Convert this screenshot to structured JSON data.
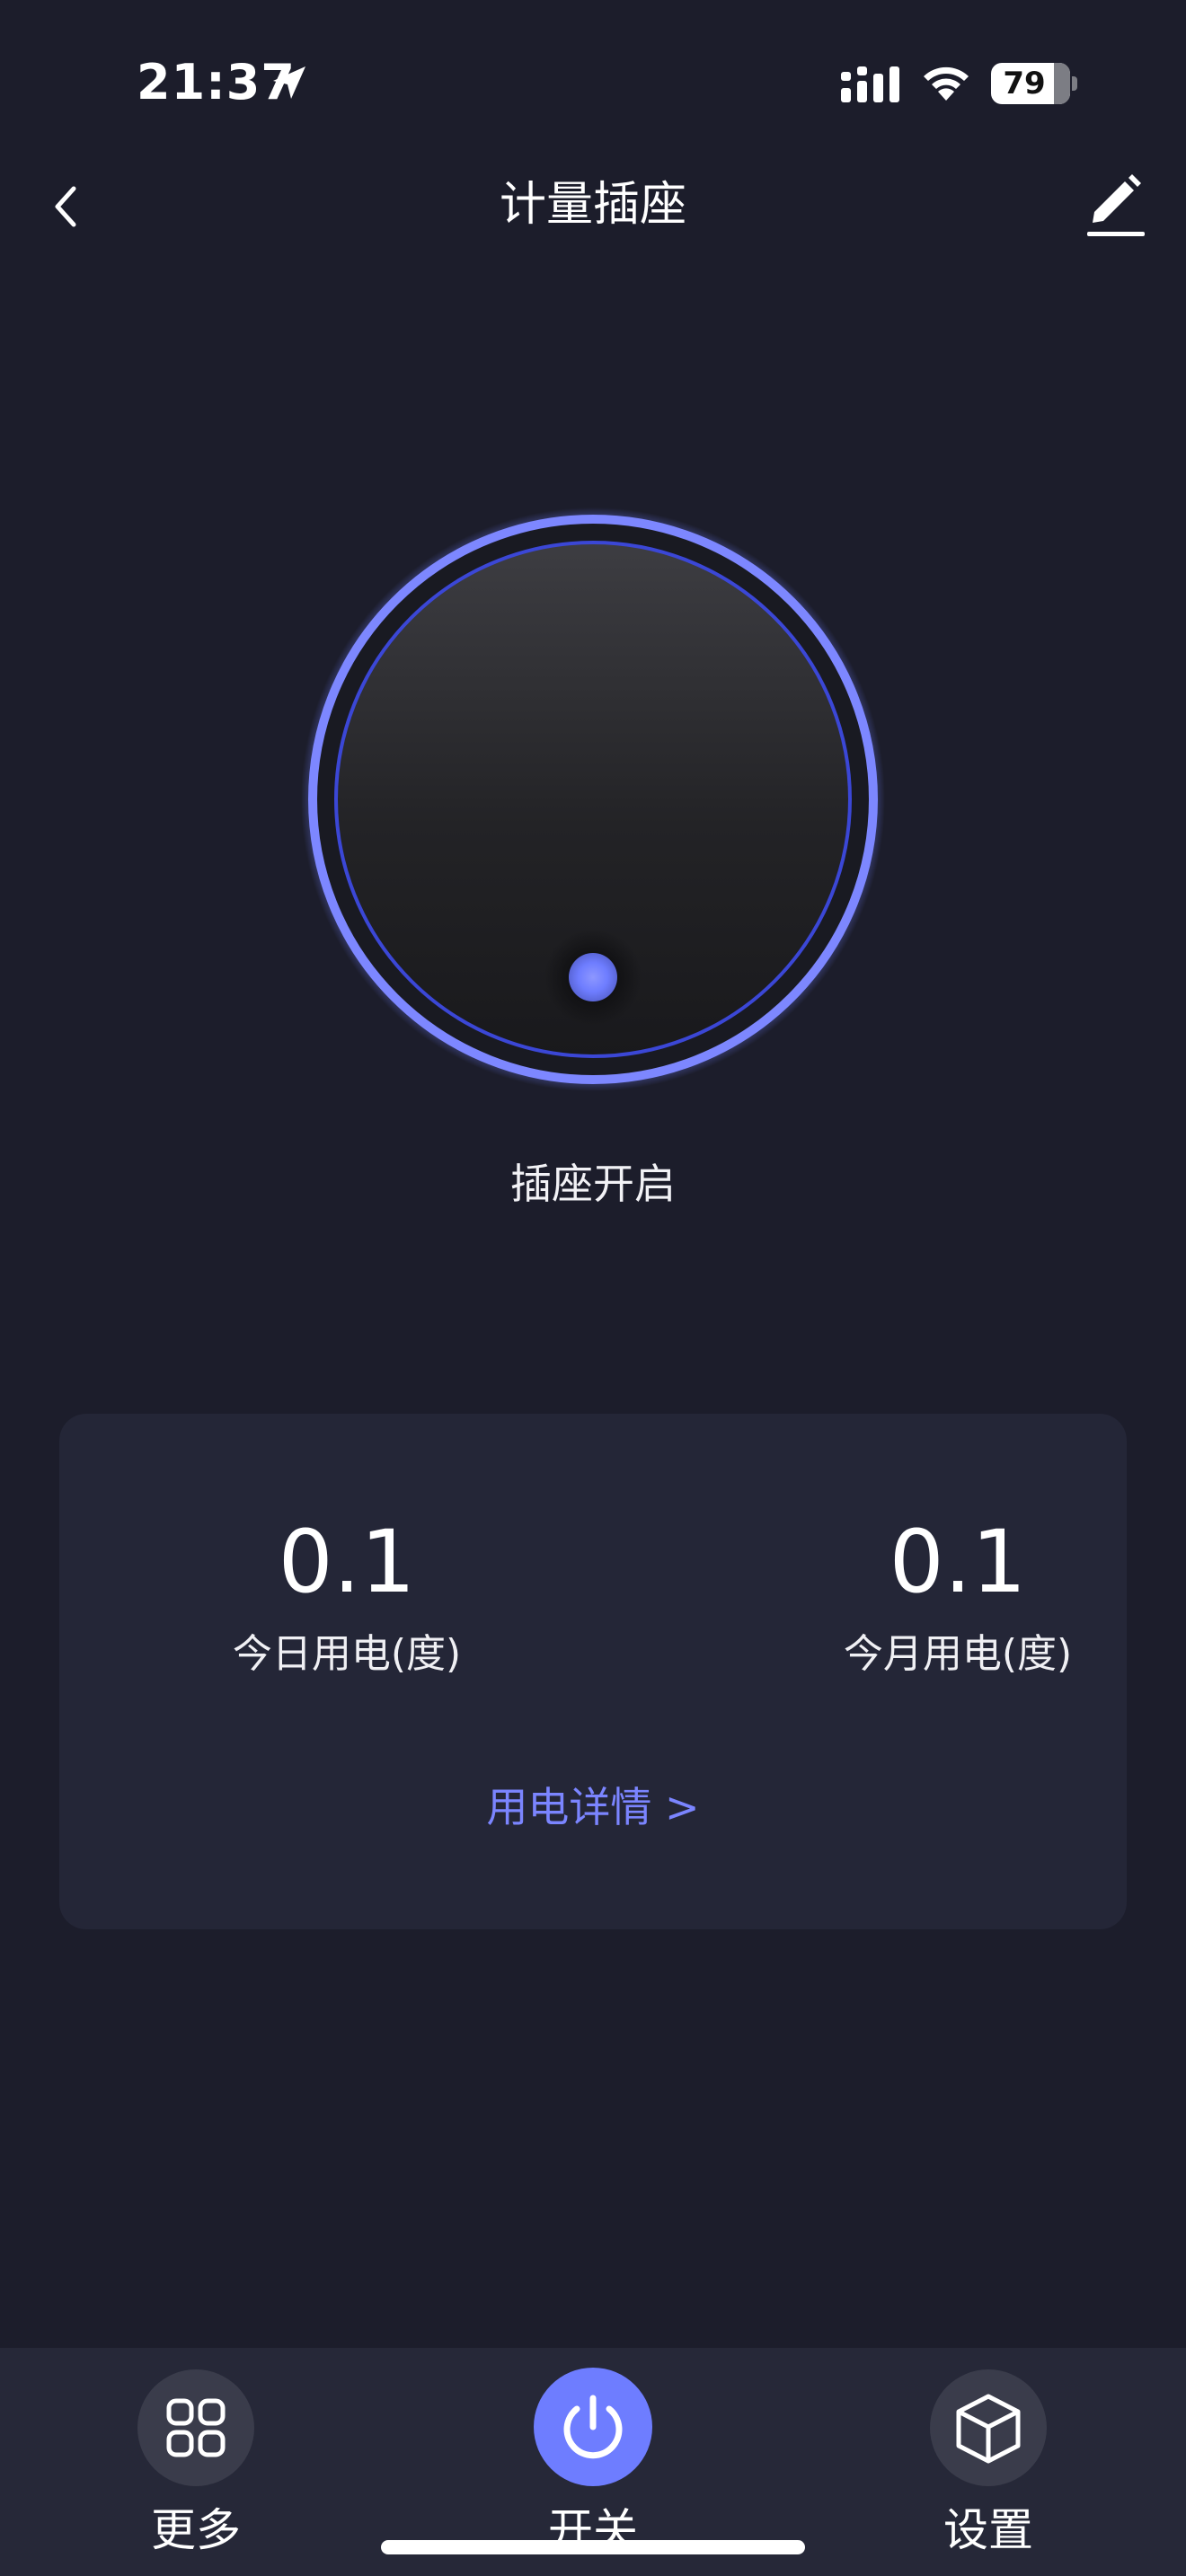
{
  "status_bar": {
    "time": "21:37",
    "battery_percent": "79",
    "battery_level": 0.79,
    "icons": [
      "location-arrow-icon",
      "cellular-signal-icon",
      "wifi-icon",
      "battery-icon"
    ]
  },
  "nav": {
    "title": "计量插座",
    "back_icon": "chevron-left-icon",
    "edit_icon": "pencil-edit-icon"
  },
  "device": {
    "state_text": "插座开启",
    "is_on": true
  },
  "usage": {
    "today_value": "0.1",
    "today_label": "今日用电(度)",
    "month_value": "0.1",
    "month_label": "今月用电(度)",
    "detail_link": "用电详情 >"
  },
  "tabs": [
    {
      "label": "更多",
      "icon": "grid-icon"
    },
    {
      "label": "开关",
      "icon": "power-icon",
      "active": true
    },
    {
      "label": "设置",
      "icon": "cube-icon"
    }
  ],
  "colors": {
    "background": "#1c1d2b",
    "card": "#242637",
    "accent": "#6e7dff",
    "link": "#7b85ff",
    "tab_bar": "#262838"
  }
}
